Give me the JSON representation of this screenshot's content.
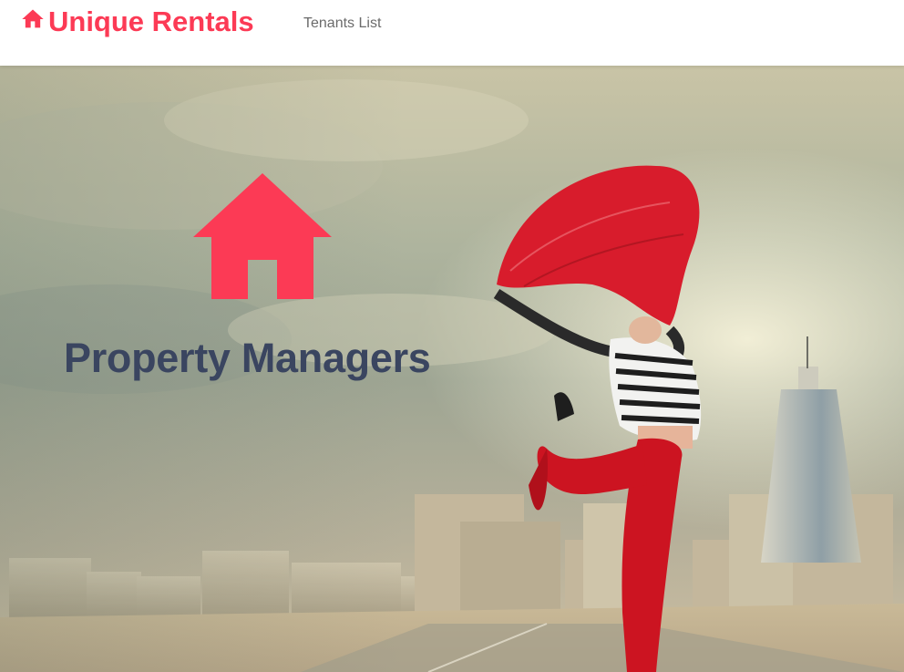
{
  "brand": {
    "name": "Unique Rentals",
    "icon": "home-icon",
    "color": "#fc3a55"
  },
  "nav": {
    "links": [
      {
        "label": "Tenants List"
      }
    ]
  },
  "hero": {
    "icon": "home-icon",
    "icon_color": "#fc3a55",
    "title": "Property Managers",
    "title_color": "#3a4560",
    "background_image": "woman-dancing-with-red-scarf-city-skyline"
  }
}
